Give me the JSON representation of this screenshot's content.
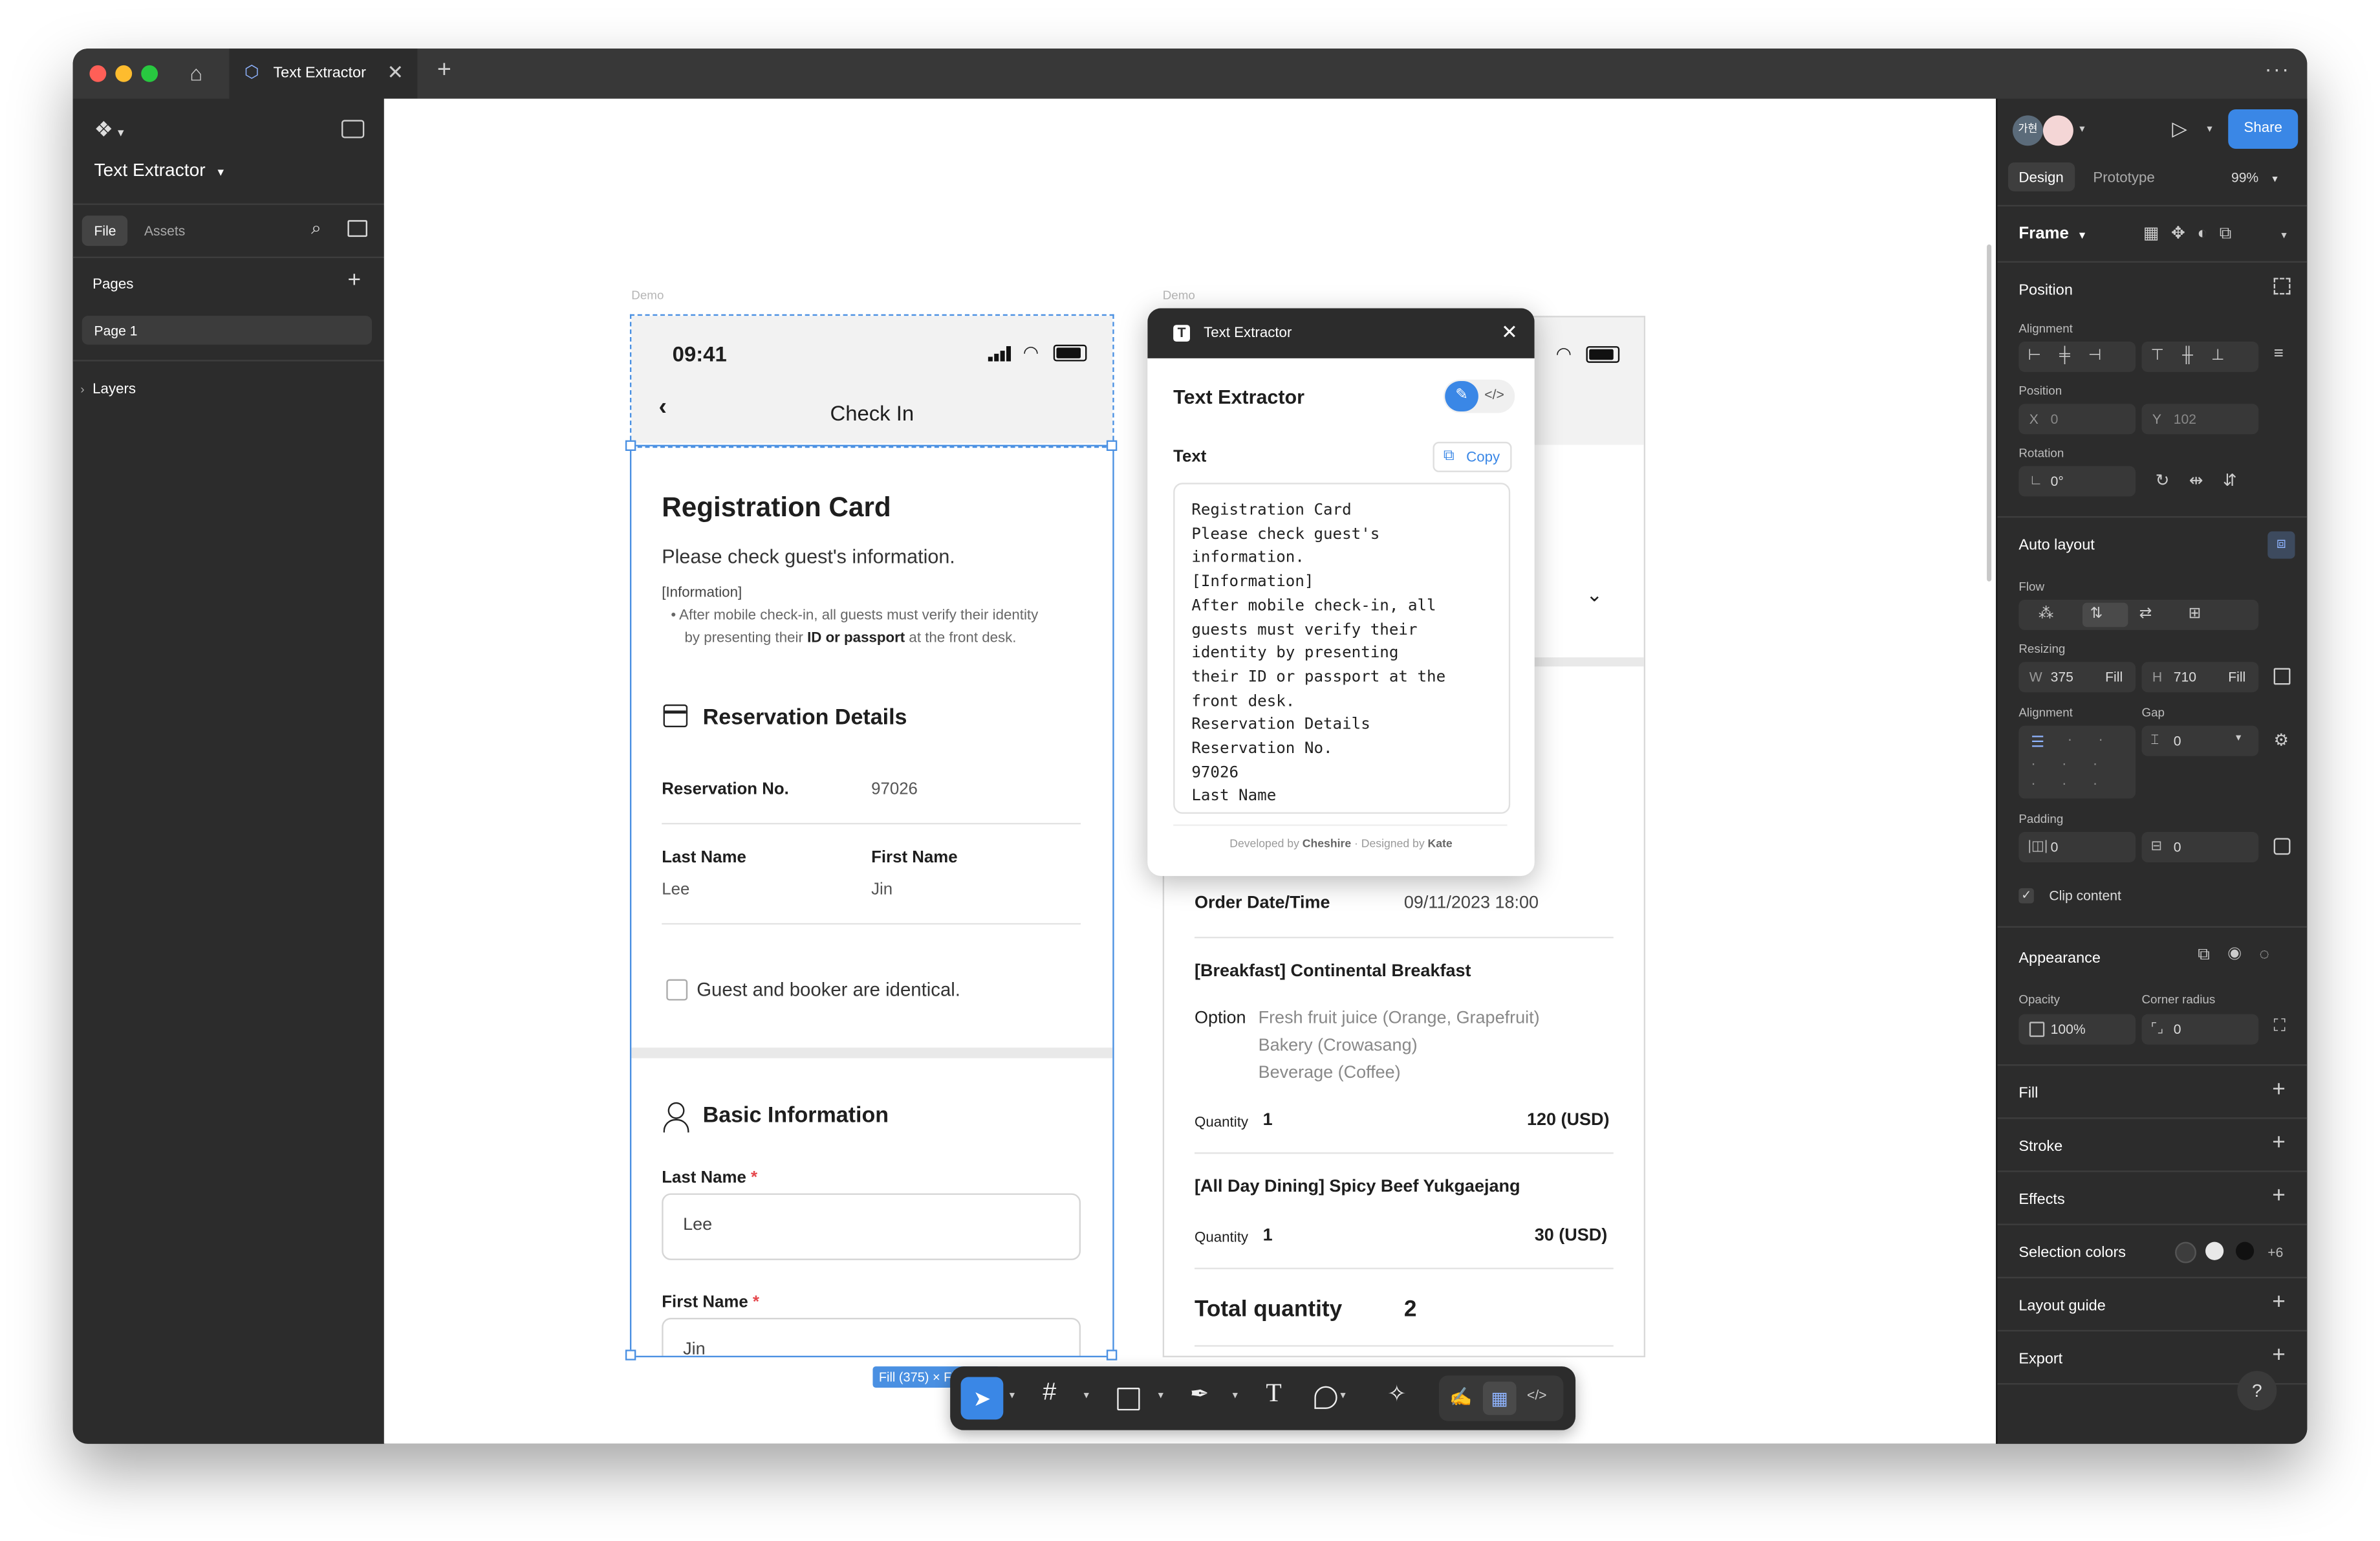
{
  "app": {
    "tab_title": "Text Extractor",
    "file_name": "Text Extractor"
  },
  "left_panel": {
    "tabs": [
      "File",
      "Assets"
    ],
    "pages_label": "Pages",
    "page_item": "Page 1",
    "layers_label": "Layers"
  },
  "canvas": {
    "frame_label_left": "Demo",
    "frame_label_right": "Demo",
    "selection_size": "Fill (375) × Fill (710)",
    "phone": {
      "time": "09:41",
      "nav_title": "Check In",
      "reg_title": "Registration Card",
      "reg_subtitle": "Please check guest's information.",
      "info_tag": "[Information]",
      "info_text_1": "After mobile check-in, all guests must verify their identity",
      "info_text_2_pre": "by presenting their ",
      "info_text_2_bold": "ID or passport",
      "info_text_2_post": " at the front desk.",
      "reservation_heading": "Reservation Details",
      "res_no_label": "Reservation No.",
      "res_no_value": "97026",
      "last_name_label": "Last Name",
      "last_name_value": "Lee",
      "first_name_label": "First Name",
      "first_name_value": "Jin",
      "checkbox_label": "Guest and booker are identical.",
      "basic_heading": "Basic Information",
      "field_last_label": "Last Name",
      "field_last_value": "Lee",
      "field_first_label": "First Name",
      "field_first_value": "Jin",
      "required_mark": "*"
    },
    "order": {
      "order_dt_label": "Order Date/Time",
      "order_dt_value": "09/11/2023 18:00",
      "item1_title": "[Breakfast] Continental Breakfast",
      "option_label": "Option",
      "option_1": "Fresh fruit juice (Orange, Grapefruit)",
      "option_2": "Bakery (Crowasang)",
      "option_3": "Beverage (Coffee)",
      "qty_label": "Quantity",
      "qty1": "1",
      "price1": "120 (USD)",
      "item2_title": "[All Day Dining] Spicy Beef Yukgaejang",
      "qty2": "1",
      "price2": "30 (USD)",
      "total_label": "Total quantity",
      "total_value": "2"
    },
    "plugin": {
      "window_title": "Text Extractor",
      "title": "Text Extractor",
      "text_label": "Text",
      "copy_label": "Copy",
      "extracted_text": "Registration Card\nPlease check guest's\ninformation.\n[Information]\nAfter mobile check-in, all\nguests must verify their\nidentity by presenting\ntheir ID or passport at the\nfront desk.\nReservation Details\nReservation No.\n97026\nLast Name",
      "footer_pre": "Developed by ",
      "footer_dev": "Cheshire",
      "footer_mid": " · Designed by ",
      "footer_designer": "Kate"
    }
  },
  "right_panel": {
    "avatar_text": "가현",
    "share_label": "Share",
    "tabs": [
      "Design",
      "Prototype"
    ],
    "zoom": "99%",
    "frame_label": "Frame",
    "position_heading": "Position",
    "alignment_label": "Alignment",
    "position_label": "Position",
    "x_label": "X",
    "x_value": "0",
    "y_label": "Y",
    "y_value": "102",
    "rotation_label": "Rotation",
    "rotation_value": "0°",
    "autolayout_heading": "Auto layout",
    "flow_label": "Flow",
    "resizing_label": "Resizing",
    "w_label": "W",
    "w_value": "375",
    "w_mode": "Fill",
    "h_label": "H",
    "h_value": "710",
    "h_mode": "Fill",
    "al_alignment_label": "Alignment",
    "gap_label": "Gap",
    "gap_value": "0",
    "padding_label": "Padding",
    "pad_h_value": "0",
    "pad_v_value": "0",
    "clip_label": "Clip content",
    "appearance_heading": "Appearance",
    "opacity_label": "Opacity",
    "opacity_value": "100%",
    "corner_label": "Corner radius",
    "corner_value": "0",
    "fill_heading": "Fill",
    "stroke_heading": "Stroke",
    "effects_heading": "Effects",
    "selection_colors_heading": "Selection colors",
    "selection_colors_more": "+6",
    "layout_guide_heading": "Layout guide",
    "export_heading": "Export",
    "help": "?"
  },
  "colors": {
    "accent": "#3a87e6",
    "panel": "#2c2c2c",
    "selection": "#4a90e2",
    "required": "#e5484d"
  }
}
